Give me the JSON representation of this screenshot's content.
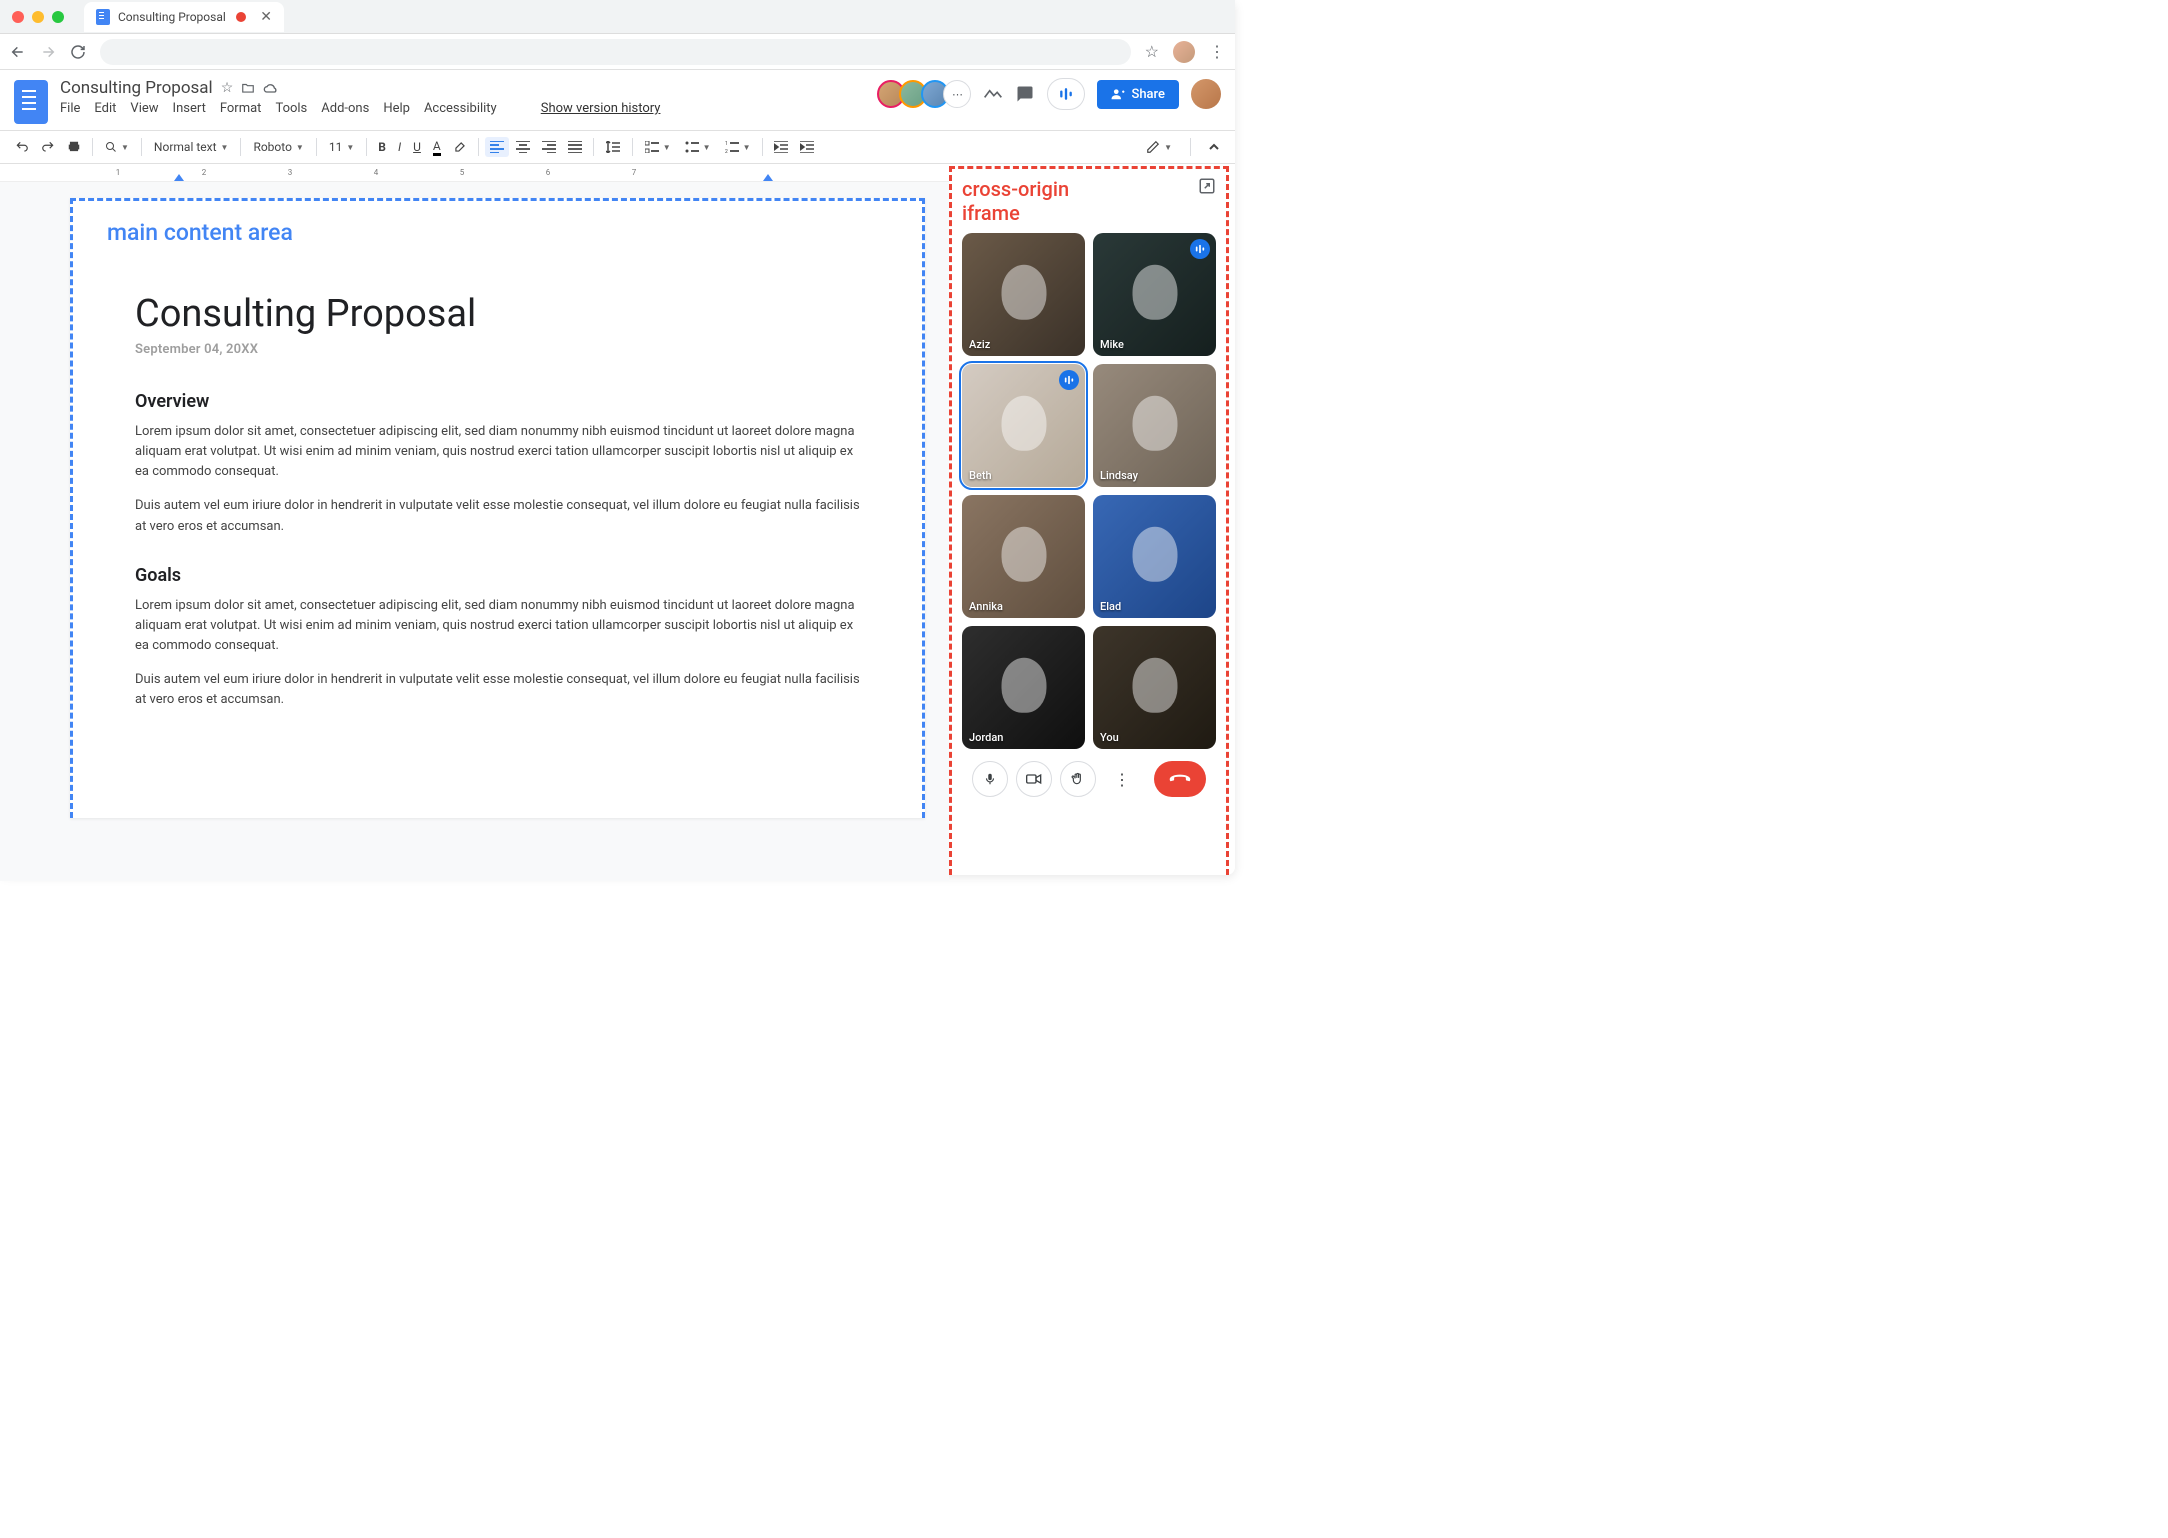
{
  "browser": {
    "tab_title": "Consulting Proposal"
  },
  "docs": {
    "title": "Consulting Proposal",
    "menu": [
      "File",
      "Edit",
      "View",
      "Insert",
      "Format",
      "Tools",
      "Add-ons",
      "Help",
      "Accessibility"
    ],
    "version_link": "Show version history",
    "share_label": "Share"
  },
  "toolbar": {
    "zoom": "",
    "style": "Normal text",
    "font": "Roboto",
    "size": "11"
  },
  "ruler": {
    "marks": [
      "1",
      "2",
      "3",
      "4",
      "5",
      "6",
      "7"
    ]
  },
  "annotations": {
    "main": "main content area",
    "iframe_l1": "cross-origin",
    "iframe_l2": "iframe"
  },
  "document": {
    "h1": "Consulting Proposal",
    "date": "September 04, 20XX",
    "sections": [
      {
        "heading": "Overview",
        "p1": "Lorem ipsum dolor sit amet, consectetuer adipiscing elit, sed diam nonummy nibh euismod tincidunt ut laoreet dolore magna aliquam erat volutpat. Ut wisi enim ad minim veniam, quis nostrud exerci tation ullamcorper suscipit lobortis nisl ut aliquip ex ea commodo consequat.",
        "p2": "Duis autem vel eum iriure dolor in hendrerit in vulputate velit esse molestie consequat, vel illum dolore eu feugiat nulla facilisis at vero eros et accumsan."
      },
      {
        "heading": "Goals",
        "p1": "Lorem ipsum dolor sit amet, consectetuer adipiscing elit, sed diam nonummy nibh euismod tincidunt ut laoreet dolore magna aliquam erat volutpat. Ut wisi enim ad minim veniam, quis nostrud exerci tation ullamcorper suscipit lobortis nisl ut aliquip ex ea commodo consequat.",
        "p2": "Duis autem vel eum iriure dolor in hendrerit in vulputate velit esse molestie consequat, vel illum dolore eu feugiat nulla facilisis at vero eros et accumsan."
      }
    ]
  },
  "meet": {
    "participants": [
      {
        "name": "Aziz",
        "c1": "#6b5a48",
        "c2": "#3a3128",
        "speaking": false,
        "active": false
      },
      {
        "name": "Mike",
        "c1": "#2a3938",
        "c2": "#151f1e",
        "speaking": true,
        "active": false
      },
      {
        "name": "Beth",
        "c1": "#d4cbc2",
        "c2": "#b5a998",
        "speaking": true,
        "active": true
      },
      {
        "name": "Lindsay",
        "c1": "#978a7c",
        "c2": "#6e6356",
        "speaking": false,
        "active": false
      },
      {
        "name": "Annika",
        "c1": "#8a7562",
        "c2": "#5f4e3e",
        "speaking": false,
        "active": false
      },
      {
        "name": "Elad",
        "c1": "#3868b5",
        "c2": "#1d4588",
        "speaking": false,
        "active": false
      },
      {
        "name": "Jordan",
        "c1": "#2e2e2e",
        "c2": "#0f0f0f",
        "speaking": false,
        "active": false
      },
      {
        "name": "You",
        "c1": "#3d352a",
        "c2": "#1f1a12",
        "speaking": false,
        "active": false
      }
    ]
  }
}
